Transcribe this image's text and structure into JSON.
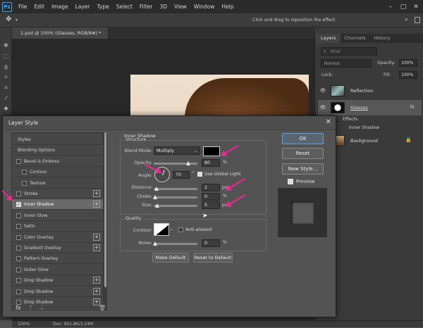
{
  "app": {
    "logo": "Ps"
  },
  "menu": [
    "File",
    "Edit",
    "Image",
    "Layer",
    "Type",
    "Select",
    "Filter",
    "3D",
    "View",
    "Window",
    "Help"
  ],
  "options_bar": {
    "hint": "Click and drag to reposition the effect."
  },
  "document_tab": {
    "label": "1.psd @ 100% (Glasses, RGB/8#) *"
  },
  "layers_panel": {
    "tabs": [
      "Layers",
      "Channels",
      "History"
    ],
    "kind_placeholder": "Kind",
    "blend_mode": "Normal",
    "opacity_label": "Opacity:",
    "opacity_value": "100%",
    "lock_label": "Lock:",
    "fill_label": "Fill:",
    "fill_value": "100%",
    "layers": [
      {
        "name": "Reflection"
      },
      {
        "name": "Glasses"
      },
      {
        "name": "Background"
      }
    ],
    "effects_label": "Effects",
    "inner_shadow_label": "Inner Shadow"
  },
  "statusbar": {
    "zoom": "100%",
    "doc": "Doc: 901.8K/3.24M"
  },
  "dialog": {
    "title": "Layer Style",
    "styles": [
      {
        "label": "Styles",
        "checkbox": false,
        "plus": false
      },
      {
        "label": "Blending Options",
        "checkbox": false,
        "plus": false
      },
      {
        "label": "Bevel & Emboss",
        "checkbox": true,
        "plus": false
      },
      {
        "label": "Contour",
        "checkbox": true,
        "plus": false,
        "indent": true
      },
      {
        "label": "Texture",
        "checkbox": true,
        "plus": false,
        "indent": true
      },
      {
        "label": "Stroke",
        "checkbox": true,
        "plus": true
      },
      {
        "label": "Inner Shadow",
        "checkbox": true,
        "plus": true,
        "checked": true,
        "selected": true
      },
      {
        "label": "Inner Glow",
        "checkbox": true,
        "plus": false
      },
      {
        "label": "Satin",
        "checkbox": true,
        "plus": false
      },
      {
        "label": "Color Overlay",
        "checkbox": true,
        "plus": true
      },
      {
        "label": "Gradient Overlay",
        "checkbox": true,
        "plus": true
      },
      {
        "label": "Pattern Overlay",
        "checkbox": true,
        "plus": false
      },
      {
        "label": "Outer Glow",
        "checkbox": true,
        "plus": false
      },
      {
        "label": "Drop Shadow",
        "checkbox": true,
        "plus": true
      },
      {
        "label": "Drop Shadow",
        "checkbox": true,
        "plus": true
      },
      {
        "label": "Drop Shadow",
        "checkbox": true,
        "plus": true
      }
    ],
    "footer_fx": "fx",
    "section_title": "Inner Shadow",
    "structure": {
      "legend": "Structure",
      "blend_mode_label": "Blend Mode:",
      "blend_mode_value": "Multiply",
      "shadow_color": "#000000",
      "opacity_label": "Opacity:",
      "opacity_value": "80",
      "opacity_fraction": 0.8,
      "angle_label": "Angle:",
      "angle_value": "70",
      "angle_unit": "°",
      "global_light_label": "Use Global Light",
      "distance_label": "Distance:",
      "distance_value": "2",
      "choke_label": "Choke:",
      "choke_value": "0",
      "size_label": "Size:",
      "size_value": "5",
      "unit_px": "px",
      "unit_pct": "%"
    },
    "quality": {
      "legend": "Quality",
      "contour_label": "Contour:",
      "anti_aliased_label": "Anti-aliased",
      "noise_label": "Noise:",
      "noise_value": "0"
    },
    "make_default": "Make Default",
    "reset_default": "Reset to Default",
    "ok": "OK",
    "reset": "Reset",
    "new_style": "New Style...",
    "preview_label": "Preview"
  },
  "colors": {
    "annotation_arrow": "#e52d91",
    "accent": "#31a8ff"
  }
}
